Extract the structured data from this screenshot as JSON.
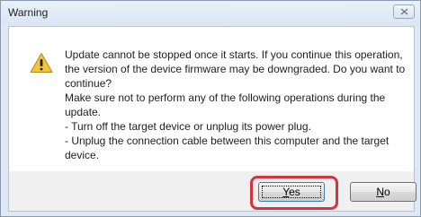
{
  "dialog": {
    "title": "Warning",
    "icon": "warning-icon",
    "message": {
      "line1": "Update cannot be stopped once it starts. If you continue this operation,",
      "line2": "the version of the device firmware may be downgraded. Do you want to",
      "line3": "continue?",
      "line4": "Make sure not to perform any of the following operations during the",
      "line5": "update.",
      "line6": "- Turn off the target device or unplug its power plug.",
      "line7": "- Unplug the connection cable between this computer and the target",
      "line8": "device."
    },
    "buttons": {
      "yes_mnemonic": "Y",
      "yes_rest": "es",
      "no_mnemonic": "N",
      "no_rest": "o"
    }
  },
  "colors": {
    "highlight": "#d7333e",
    "warning_fill": "#f5c33b"
  }
}
